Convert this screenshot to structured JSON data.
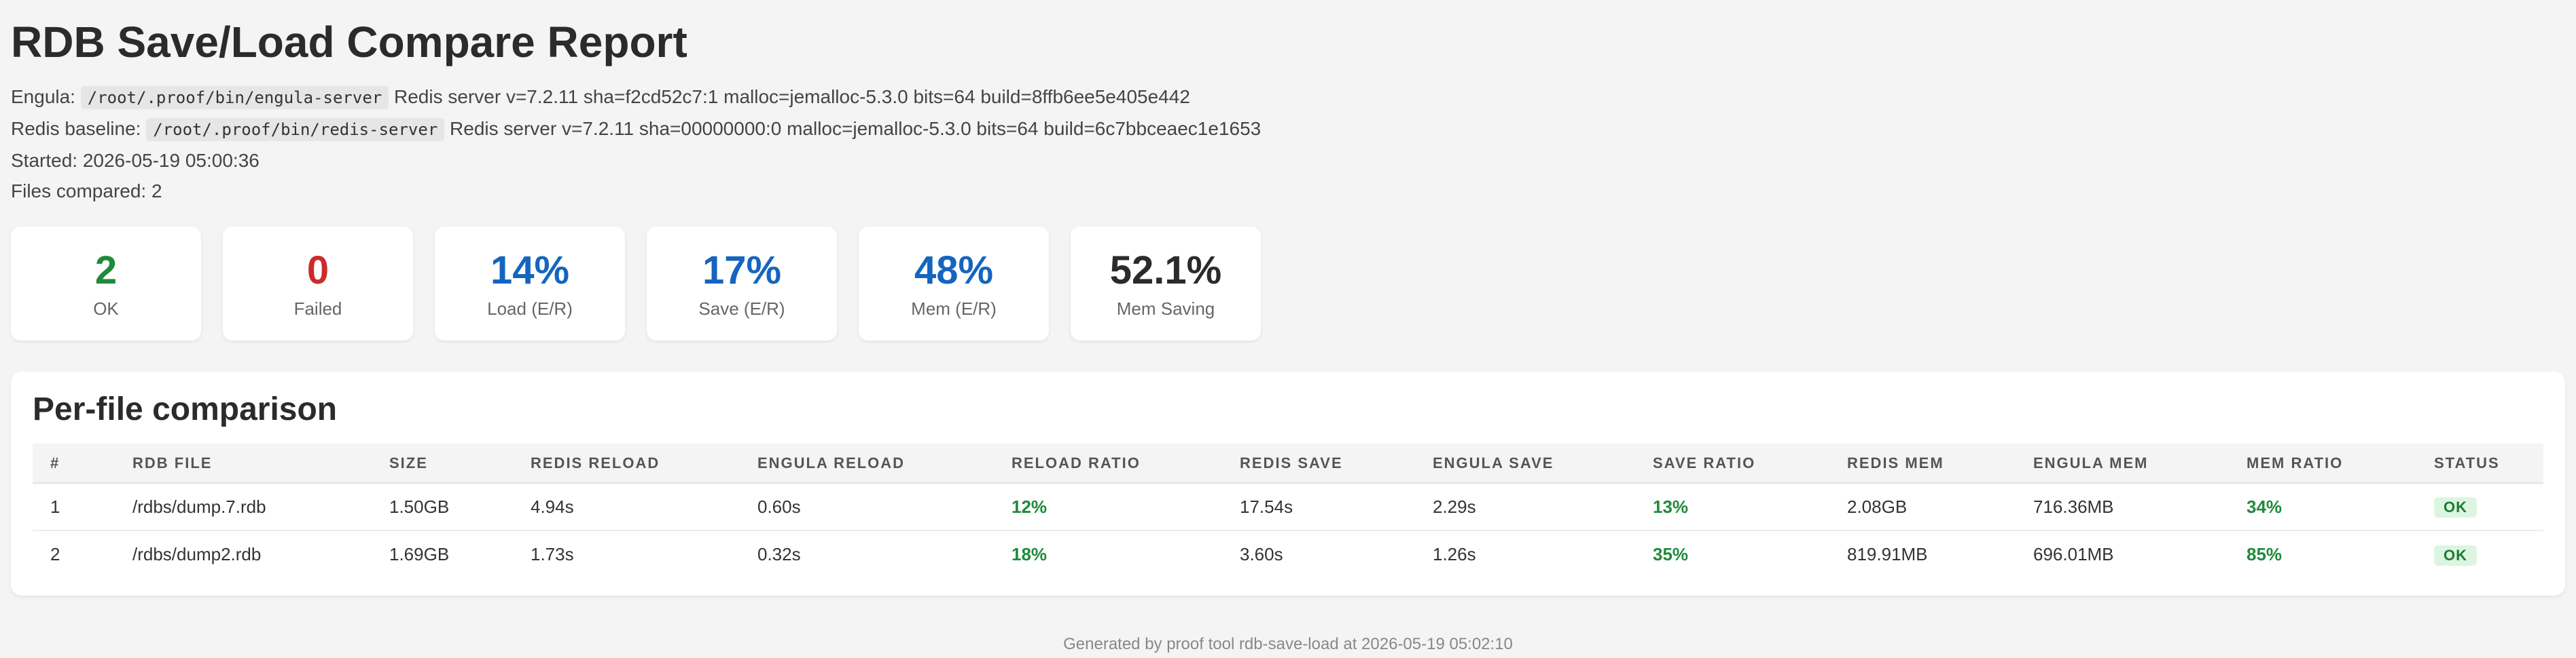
{
  "title": "RDB Save/Load Compare Report",
  "meta": {
    "engula_label": "Engula:",
    "engula_path": "/root/.proof/bin/engula-server",
    "engula_info": "Redis server v=7.2.11 sha=f2cd52c7:1 malloc=jemalloc-5.3.0 bits=64 build=8ffb6ee5e405e442",
    "redis_label": "Redis baseline:",
    "redis_path": "/root/.proof/bin/redis-server",
    "redis_info": "Redis server v=7.2.11 sha=00000000:0 malloc=jemalloc-5.3.0 bits=64 build=6c7bbceaec1e1653",
    "started": "Started: 2026-05-19 05:00:36",
    "files_compared": "Files compared: 2"
  },
  "cards": [
    {
      "value": "2",
      "label": "OK",
      "color": "#1f8a3a"
    },
    {
      "value": "0",
      "label": "Failed",
      "color": "#cc2b2b"
    },
    {
      "value": "14%",
      "label": "Load (E/R)",
      "color": "#1565c0"
    },
    {
      "value": "17%",
      "label": "Save (E/R)",
      "color": "#1565c0"
    },
    {
      "value": "48%",
      "label": "Mem (E/R)",
      "color": "#1565c0"
    },
    {
      "value": "52.1%",
      "label": "Mem Saving",
      "color": "#2b2b2b"
    }
  ],
  "table": {
    "heading": "Per-file comparison",
    "columns": [
      "#",
      "RDB File",
      "Size",
      "Redis Reload",
      "Engula Reload",
      "Reload Ratio",
      "Redis Save",
      "Engula Save",
      "Save Ratio",
      "Redis Mem",
      "Engula Mem",
      "Mem Ratio",
      "Status"
    ],
    "rows": [
      {
        "num": "1",
        "file": "/rdbs/dump.7.rdb",
        "size": "1.50GB",
        "redis_reload": "4.94s",
        "engula_reload": "0.60s",
        "reload_ratio": "12%",
        "redis_save": "17.54s",
        "engula_save": "2.29s",
        "save_ratio": "13%",
        "redis_mem": "2.08GB",
        "engula_mem": "716.36MB",
        "mem_ratio": "34%",
        "status": "OK"
      },
      {
        "num": "2",
        "file": "/rdbs/dump2.rdb",
        "size": "1.69GB",
        "redis_reload": "1.73s",
        "engula_reload": "0.32s",
        "reload_ratio": "18%",
        "redis_save": "3.60s",
        "engula_save": "1.26s",
        "save_ratio": "35%",
        "redis_mem": "819.91MB",
        "engula_mem": "696.01MB",
        "mem_ratio": "85%",
        "status": "OK"
      }
    ]
  },
  "footer": "Generated by proof tool rdb-save-load at 2026-05-19 05:02:10"
}
